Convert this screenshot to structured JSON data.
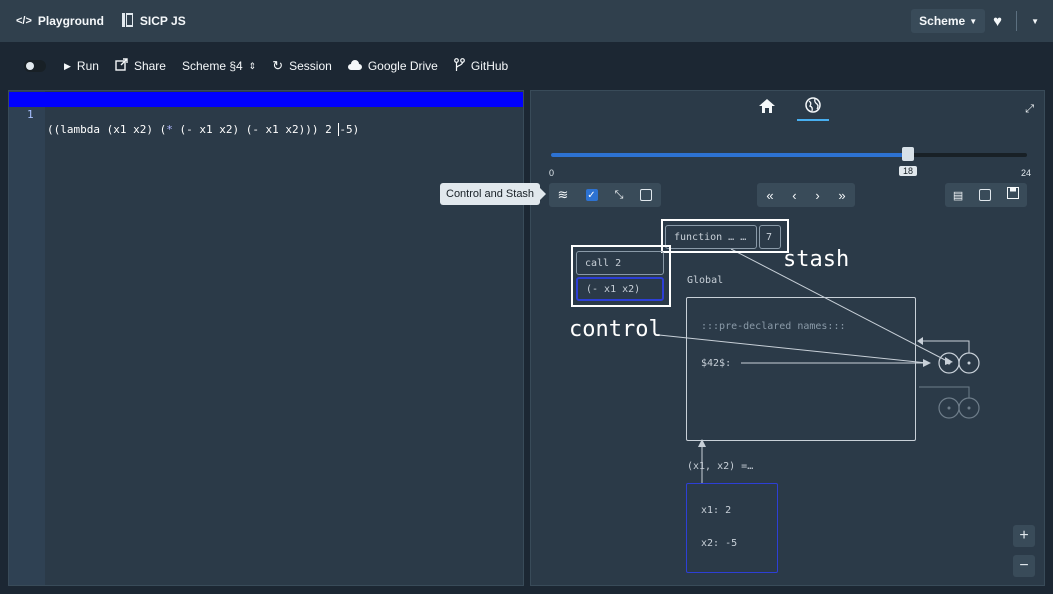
{
  "topbar": {
    "playground_label": "Playground",
    "book_label": "SICP JS",
    "language": "Scheme"
  },
  "toolbar": {
    "run": "Run",
    "share": "Share",
    "chapter": "Scheme §4",
    "session": "Session",
    "drive": "Google Drive",
    "github": "GitHub"
  },
  "editor": {
    "line_number": "1",
    "code_main": "((lambda (x1 x2) (",
    "code_star": "*",
    "code_rest": " (- x1 x2) (- x1 x2))) 2 ",
    "code_cursor": "-5)"
  },
  "viz": {
    "slider": {
      "min": "0",
      "max": "24",
      "value": "18",
      "fraction": 0.75
    },
    "tooltip": "Control and Stash",
    "control_items": [
      "call 2",
      "(- x1 x2)"
    ],
    "control_label": "control",
    "stash_items": [
      "function … …",
      "7"
    ],
    "stash_label": "stash",
    "global_label": "Global",
    "predeclared": ":::pre-declared names:::",
    "binding": "$42$:",
    "frame_label": "(x1, x2) =…",
    "frame_bindings": [
      "x1:  2",
      "x2:  -5"
    ],
    "zoom_in": "+",
    "zoom_out": "−"
  },
  "icons": {
    "code": "code-icon",
    "book": "book-icon",
    "heart": "heart-icon",
    "run": "play-icon",
    "share": "share-icon",
    "session": "session-icon",
    "cloud": "cloud-icon",
    "github": "git-branch-icon"
  },
  "colors": {
    "accent": "#2d72d2",
    "highlight": "#0000ff",
    "topbar": "#30404d",
    "panel": "#2b3a48"
  }
}
